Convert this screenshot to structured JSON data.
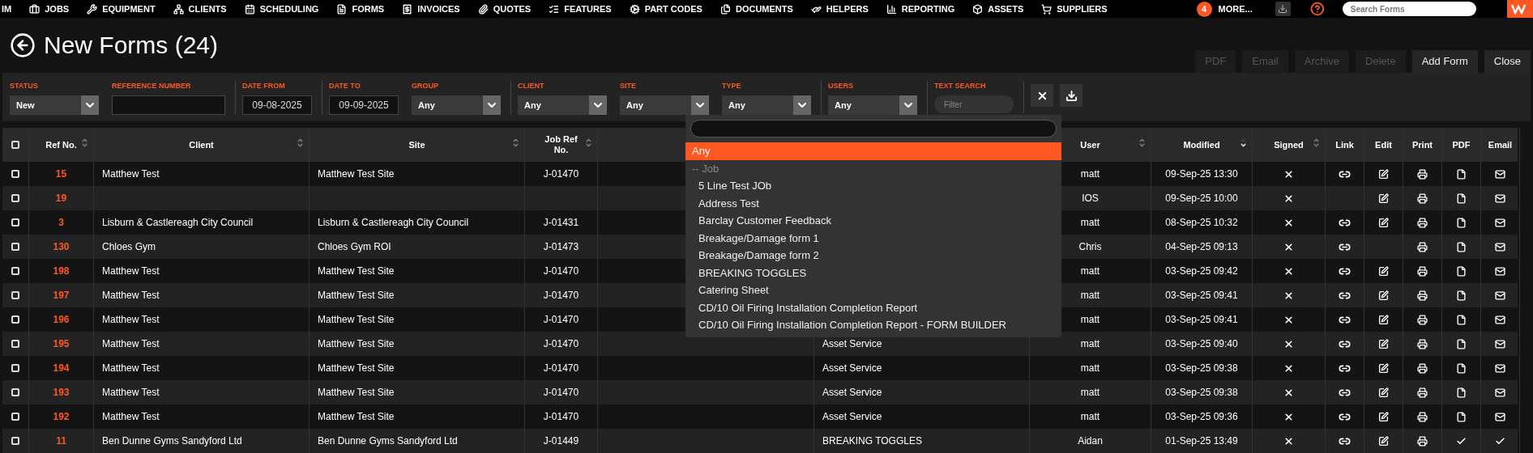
{
  "nav": {
    "items": [
      {
        "label": "IM"
      },
      {
        "label": "JOBS"
      },
      {
        "label": "EQUIPMENT"
      },
      {
        "label": "CLIENTS"
      },
      {
        "label": "SCHEDULING"
      },
      {
        "label": "FORMS"
      },
      {
        "label": "INVOICES"
      },
      {
        "label": "QUOTES"
      },
      {
        "label": "FEATURES"
      },
      {
        "label": "PART CODES"
      },
      {
        "label": "DOCUMENTS"
      },
      {
        "label": "HELPERS"
      },
      {
        "label": "REPORTING"
      },
      {
        "label": "ASSETS"
      },
      {
        "label": "SUPPLIERS"
      }
    ],
    "more": {
      "badge": "4",
      "label": "MORE..."
    },
    "search": {
      "placeholder": "Search Forms"
    }
  },
  "page": {
    "title": "New Forms (24)"
  },
  "actions": [
    {
      "label": "PDF",
      "disabled": true
    },
    {
      "label": "Email",
      "disabled": true
    },
    {
      "label": "Archive",
      "disabled": true
    },
    {
      "label": "Delete",
      "disabled": true
    },
    {
      "label": "Add Form",
      "disabled": false
    },
    {
      "label": "Close",
      "disabled": false
    }
  ],
  "filters": [
    {
      "kind": "select",
      "label": "STATUS",
      "value": "New"
    },
    {
      "kind": "input",
      "label": "REFERENCE NUMBER"
    },
    {
      "kind": "date",
      "label": "DATE FROM",
      "value": "09-08-2025"
    },
    {
      "kind": "date",
      "label": "DATE TO",
      "value": "09-09-2025"
    },
    {
      "kind": "select",
      "label": "GROUP",
      "value": "Any"
    },
    {
      "kind": "select",
      "label": "CLIENT",
      "value": "Any"
    },
    {
      "kind": "select",
      "label": "SITE",
      "value": "Any"
    },
    {
      "kind": "select",
      "label": "TYPE",
      "value": "Any"
    },
    {
      "kind": "select",
      "label": "USERS",
      "value": "Any"
    },
    {
      "kind": "search",
      "label": "TEXT SEARCH",
      "placeholder": "Filter"
    }
  ],
  "type_dropdown": {
    "options": [
      {
        "kind": "option",
        "label": "Any",
        "selected": true
      },
      {
        "kind": "group",
        "label": "-- Job"
      },
      {
        "kind": "option",
        "label": "5 Line Test JOb",
        "selected": false
      },
      {
        "kind": "option",
        "label": "Address Test",
        "selected": false
      },
      {
        "kind": "option",
        "label": "Barclay Customer Feedback",
        "selected": false
      },
      {
        "kind": "option",
        "label": "Breakage/Damage form 1",
        "selected": false
      },
      {
        "kind": "option",
        "label": "Breakage/Damage form 2",
        "selected": false
      },
      {
        "kind": "option",
        "label": "BREAKING TOGGLES",
        "selected": false
      },
      {
        "kind": "option",
        "label": "Catering Sheet",
        "selected": false
      },
      {
        "kind": "option",
        "label": "CD/10 Oil Firing Installation Completion Report",
        "selected": false
      },
      {
        "kind": "option",
        "label": "CD/10 Oil Firing Installation Completion Report - FORM BUILDER",
        "selected": false
      }
    ]
  },
  "table": {
    "columns": [
      {
        "kind": "checkbox",
        "checked": false
      },
      {
        "label": "Ref No.",
        "sortable": true,
        "sorted": false
      },
      {
        "label": "Client",
        "sortable": true,
        "sorted": false
      },
      {
        "label": "Site",
        "sortable": true,
        "sorted": false
      },
      {
        "label": "Job Ref No.",
        "sortable": true,
        "sorted": false
      },
      {},
      {},
      {
        "label": "User",
        "sortable": true,
        "sorted": false
      },
      {
        "label": "Modified",
        "sortable": true,
        "sorted": true
      },
      {
        "label": "Signed",
        "sortable": true,
        "sorted": false
      },
      {
        "label": "Link"
      },
      {
        "label": "Edit"
      },
      {
        "label": "Print"
      },
      {
        "label": "PDF"
      },
      {
        "label": "Email"
      }
    ],
    "rows": [
      {
        "checked": false,
        "ref": "15",
        "client": "Matthew Test",
        "site": "Matthew Test Site",
        "job_ref": "J-01470",
        "user": "matt",
        "modified": "09-Sep-25 13:30",
        "signed": false,
        "link": true,
        "edit": true,
        "pdf_done": false,
        "email_done": false
      },
      {
        "checked": false,
        "ref": "19",
        "user": "IOS",
        "modified": "09-Sep-25 10:00",
        "signed": false,
        "link": false,
        "edit": true,
        "pdf_done": false,
        "email_done": false
      },
      {
        "checked": false,
        "ref": "3",
        "client": "Lisburn & Castlereagh City Council",
        "site": "Lisburn & Castlereagh City Council",
        "job_ref": "J-01431",
        "user": "matt",
        "modified": "08-Sep-25 10:32",
        "signed": false,
        "link": true,
        "edit": true,
        "pdf_done": false,
        "email_done": false
      },
      {
        "checked": false,
        "ref": "130",
        "client": "Chloes Gym",
        "site": "Chloes Gym ROI",
        "job_ref": "J-01473",
        "user": "Chris",
        "modified": "04-Sep-25 09:13",
        "signed": false,
        "link": true,
        "edit": false,
        "pdf_done": false,
        "email_done": false
      },
      {
        "checked": false,
        "ref": "198",
        "client": "Matthew Test",
        "site": "Matthew Test Site",
        "job_ref": "J-01470",
        "user": "matt",
        "modified": "03-Sep-25 09:42",
        "signed": false,
        "link": true,
        "edit": true,
        "pdf_done": false,
        "email_done": false
      },
      {
        "checked": false,
        "ref": "197",
        "client": "Matthew Test",
        "site": "Matthew Test Site",
        "job_ref": "J-01470",
        "user": "matt",
        "modified": "03-Sep-25 09:41",
        "signed": false,
        "link": true,
        "edit": true,
        "pdf_done": false,
        "email_done": false
      },
      {
        "checked": false,
        "ref": "196",
        "client": "Matthew Test",
        "site": "Matthew Test Site",
        "job_ref": "J-01470",
        "user": "matt",
        "modified": "03-Sep-25 09:41",
        "signed": false,
        "link": true,
        "edit": true,
        "pdf_done": false,
        "email_done": false
      },
      {
        "checked": false,
        "ref": "195",
        "client": "Matthew Test",
        "site": "Matthew Test Site",
        "job_ref": "J-01470",
        "form_type": "Asset Service",
        "user": "matt",
        "modified": "03-Sep-25 09:40",
        "signed": false,
        "link": true,
        "edit": true,
        "pdf_done": false,
        "email_done": false
      },
      {
        "checked": false,
        "ref": "194",
        "client": "Matthew Test",
        "site": "Matthew Test Site",
        "job_ref": "J-01470",
        "form_type": "Asset Service",
        "user": "matt",
        "modified": "03-Sep-25 09:38",
        "signed": false,
        "link": true,
        "edit": true,
        "pdf_done": false,
        "email_done": false
      },
      {
        "checked": false,
        "ref": "193",
        "client": "Matthew Test",
        "site": "Matthew Test Site",
        "job_ref": "J-01470",
        "form_type": "Asset Service",
        "user": "matt",
        "modified": "03-Sep-25 09:38",
        "signed": false,
        "link": true,
        "edit": true,
        "pdf_done": false,
        "email_done": false
      },
      {
        "checked": false,
        "ref": "192",
        "client": "Matthew Test",
        "site": "Matthew Test Site",
        "job_ref": "J-01470",
        "form_type": "Asset Service",
        "user": "matt",
        "modified": "03-Sep-25 09:36",
        "signed": false,
        "link": true,
        "edit": true,
        "pdf_done": false,
        "email_done": false
      },
      {
        "checked": false,
        "ref": "11",
        "client": "Ben Dunne Gyms Sandyford Ltd",
        "site": "Ben Dunne Gyms Sandyford Ltd",
        "job_ref": "J-01449",
        "form_type": "BREAKING TOGGLES",
        "user": "Aidan",
        "modified": "01-Sep-25 13:49",
        "signed": false,
        "link": true,
        "edit": true,
        "pdf_done": true,
        "email_done": true
      }
    ]
  }
}
